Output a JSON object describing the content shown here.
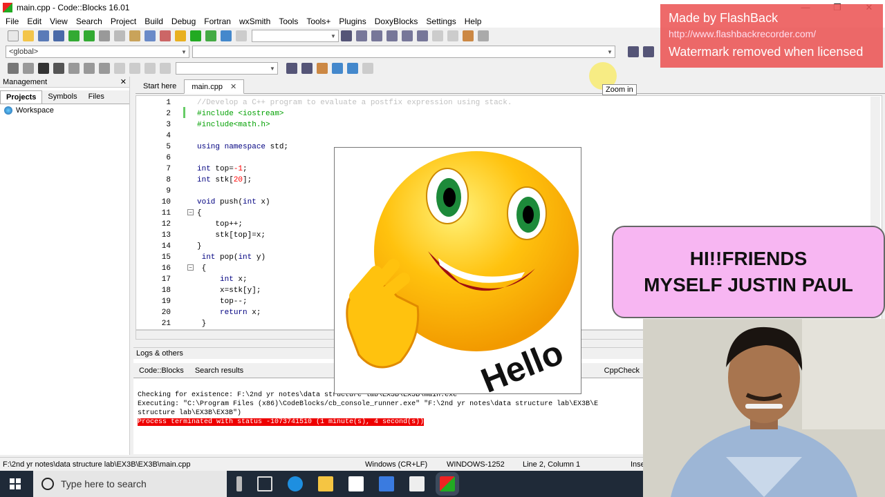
{
  "window": {
    "title": "main.cpp - Code::Blocks 16.01",
    "min": "—",
    "max": "❐",
    "close": "✕"
  },
  "menu": [
    "File",
    "Edit",
    "View",
    "Search",
    "Project",
    "Build",
    "Debug",
    "Fortran",
    "wxSmith",
    "Tools",
    "Tools+",
    "Plugins",
    "DoxyBlocks",
    "Settings",
    "Help"
  ],
  "scope_combo": "<global>",
  "management": {
    "title": "Management",
    "close": "✕",
    "tabs": [
      "Projects",
      "Symbols",
      "Files"
    ],
    "workspace": "Workspace"
  },
  "editor_tabs": [
    "Start here",
    "main.cpp"
  ],
  "editor_tab_close": "✕",
  "tooltip": "Zoom in",
  "code_lines": [
    {
      "n": "1",
      "html": "<span class='cm'>//Develop a C++ program to evaluate a postfix expression using stack.</span>"
    },
    {
      "n": "2",
      "html": "<span class='pp'>#include &lt;iostream&gt;</span>"
    },
    {
      "n": "3",
      "html": "<span class='pp'>#include&lt;math.h&gt;</span>"
    },
    {
      "n": "4",
      "html": ""
    },
    {
      "n": "5",
      "html": "<span class='kw'>using namespace</span> std;"
    },
    {
      "n": "6",
      "html": ""
    },
    {
      "n": "7",
      "html": "<span class='kw'>int</span> top=<span class='nm'>-1</span>;"
    },
    {
      "n": "8",
      "html": "<span class='kw'>int</span> stk[<span class='nm'>20</span>];"
    },
    {
      "n": "9",
      "html": ""
    },
    {
      "n": "10",
      "html": "<span class='kw'>void</span> push(<span class='kw'>int</span> x)"
    },
    {
      "n": "11",
      "html": "{"
    },
    {
      "n": "12",
      "html": "    top++;"
    },
    {
      "n": "13",
      "html": "    stk[top]=x;"
    },
    {
      "n": "14",
      "html": "}"
    },
    {
      "n": "15",
      "html": " <span class='kw'>int</span> pop(<span class='kw'>int</span> y)"
    },
    {
      "n": "16",
      "html": " {"
    },
    {
      "n": "17",
      "html": "     <span class='kw'>int</span> x;"
    },
    {
      "n": "18",
      "html": "     x=stk[y];"
    },
    {
      "n": "19",
      "html": "     top--;"
    },
    {
      "n": "20",
      "html": "     <span class='kw'>return</span> x;"
    },
    {
      "n": "21",
      "html": " }"
    }
  ],
  "logs": {
    "title": "Logs & others",
    "tabs": [
      "Code::Blocks",
      "Search results",
      "CppCheck"
    ],
    "lines": [
      "Checking for existence: F:\\2nd yr notes\\data structure lab\\EX3B\\EX3B\\main.exe",
      "Executing: \"C:\\Program Files (x86)\\CodeBlocks/cb_console_runner.exe\" \"F:\\2nd yr notes\\data structure lab\\EX3B\\E",
      "structure lab\\EX3B\\EX3B\")"
    ],
    "error": "Process terminated with status -1073741510 (1 minute(s), 4 second(s))"
  },
  "status": {
    "path": "F:\\2nd yr notes\\data structure lab\\EX3B\\EX3B\\main.cpp",
    "eol": "Windows (CR+LF)",
    "enc": "WINDOWS-1252",
    "pos": "Line 2, Column 1",
    "ins": "Inse"
  },
  "taskbar": {
    "search_placeholder": "Type here to search"
  },
  "overlay": {
    "watermark_1": "Made by FlashBack",
    "watermark_2": "http://www.flashbackrecorder.com/",
    "watermark_3": "Watermark removed when licensed",
    "bubble_line1": "HI!!FRIENDS",
    "bubble_line2": "MYSELF JUSTIN PAUL",
    "sticker_text": "Hello"
  },
  "colors": {
    "accent": "#2a6ab8",
    "error": "#e00000",
    "bubble": "#f7b6f2"
  }
}
